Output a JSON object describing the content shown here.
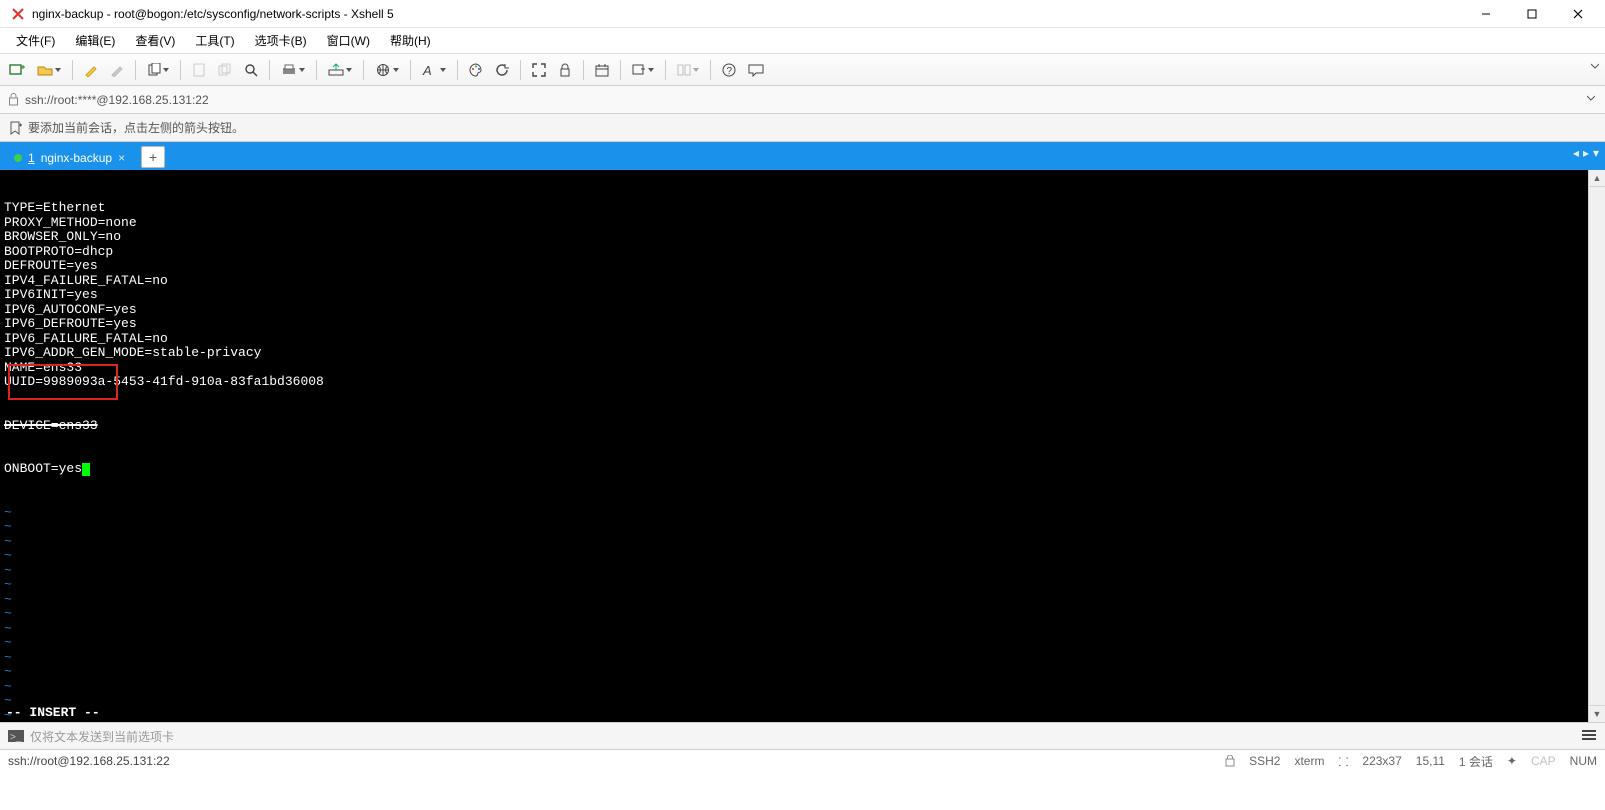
{
  "window": {
    "title": "nginx-backup - root@bogon:/etc/sysconfig/network-scripts - Xshell 5"
  },
  "menu": {
    "file": "文件(F)",
    "edit": "编辑(E)",
    "view": "查看(V)",
    "tools": "工具(T)",
    "tabs": "选项卡(B)",
    "window": "窗口(W)",
    "help": "帮助(H)"
  },
  "address": "ssh://root:****@192.168.25.131:22",
  "hint": "要添加当前会话，点击左侧的箭头按钮。",
  "tab": {
    "index": "1",
    "label": "nginx-backup"
  },
  "terminal": {
    "lines": [
      "TYPE=Ethernet",
      "PROXY_METHOD=none",
      "BROWSER_ONLY=no",
      "BOOTPROTO=dhcp",
      "DEFROUTE=yes",
      "IPV4_FAILURE_FATAL=no",
      "IPV6INIT=yes",
      "IPV6_AUTOCONF=yes",
      "IPV6_DEFROUTE=yes",
      "IPV6_FAILURE_FATAL=no",
      "IPV6_ADDR_GEN_MODE=stable-privacy",
      "NAME=ens33",
      "UUID=9989093a-5453-41fd-910a-83fa1bd36008"
    ],
    "strike_line": "DEVICE=ens33",
    "onboot_line": "ONBOOT=yes",
    "mode": "-- INSERT --"
  },
  "cmd_placeholder": "仅将文本发送到当前选项卡",
  "status": {
    "left": "ssh://root@192.168.25.131:22",
    "ssh": "SSH2",
    "term": "xterm",
    "size": "223x37",
    "pos": "15,11",
    "enc": "1 会话",
    "cap": "CAP",
    "num": "NUM"
  }
}
